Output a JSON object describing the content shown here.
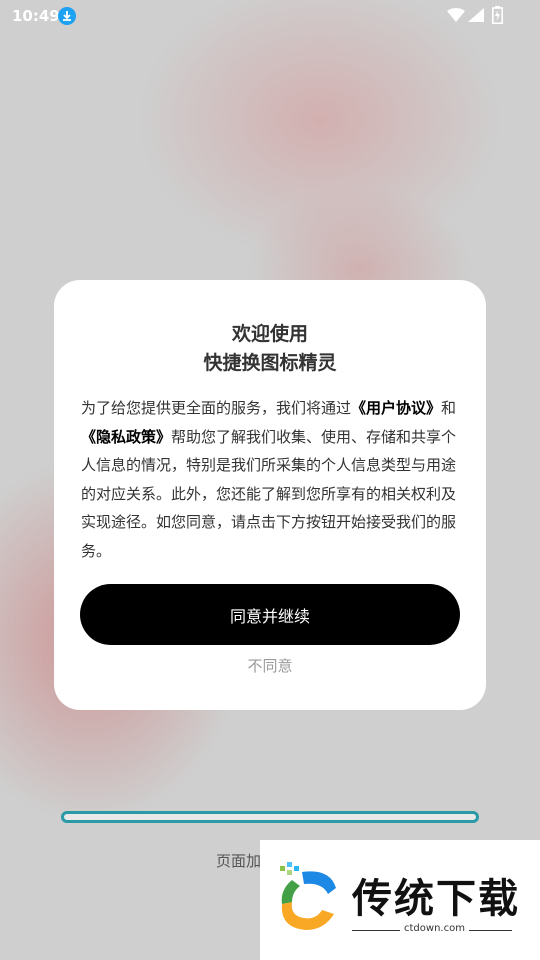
{
  "status_bar": {
    "time": "10:49",
    "icons": [
      "download-icon",
      "wifi-icon",
      "signal-icon",
      "battery-icon"
    ]
  },
  "dialog": {
    "title_line1": "欢迎使用",
    "title_line2": "快捷换图标精灵",
    "body_parts": [
      "为了给您提供更全面的服务，我们将通过",
      "《用户协议》",
      "和",
      "《隐私政策》",
      "帮助您了解我们收集、使用、存储和共享个人信息的情况，特别是我们所采集的个人信息类型与用途的对应关系。此外，您还能了解到您所享有的相关权利及实现途径。如您同意，请点击下方按钮开始接受我们的服务。"
    ],
    "agree_label": "同意并继续",
    "disagree_label": "不同意"
  },
  "loading": {
    "text": "页面加",
    "progress": 0
  },
  "watermark": {
    "brand": "传统下载",
    "url": "ctdown.com"
  },
  "colors": {
    "accent": "#2a9aa7",
    "button": "#000000",
    "download_icon": "#1da1f2"
  }
}
